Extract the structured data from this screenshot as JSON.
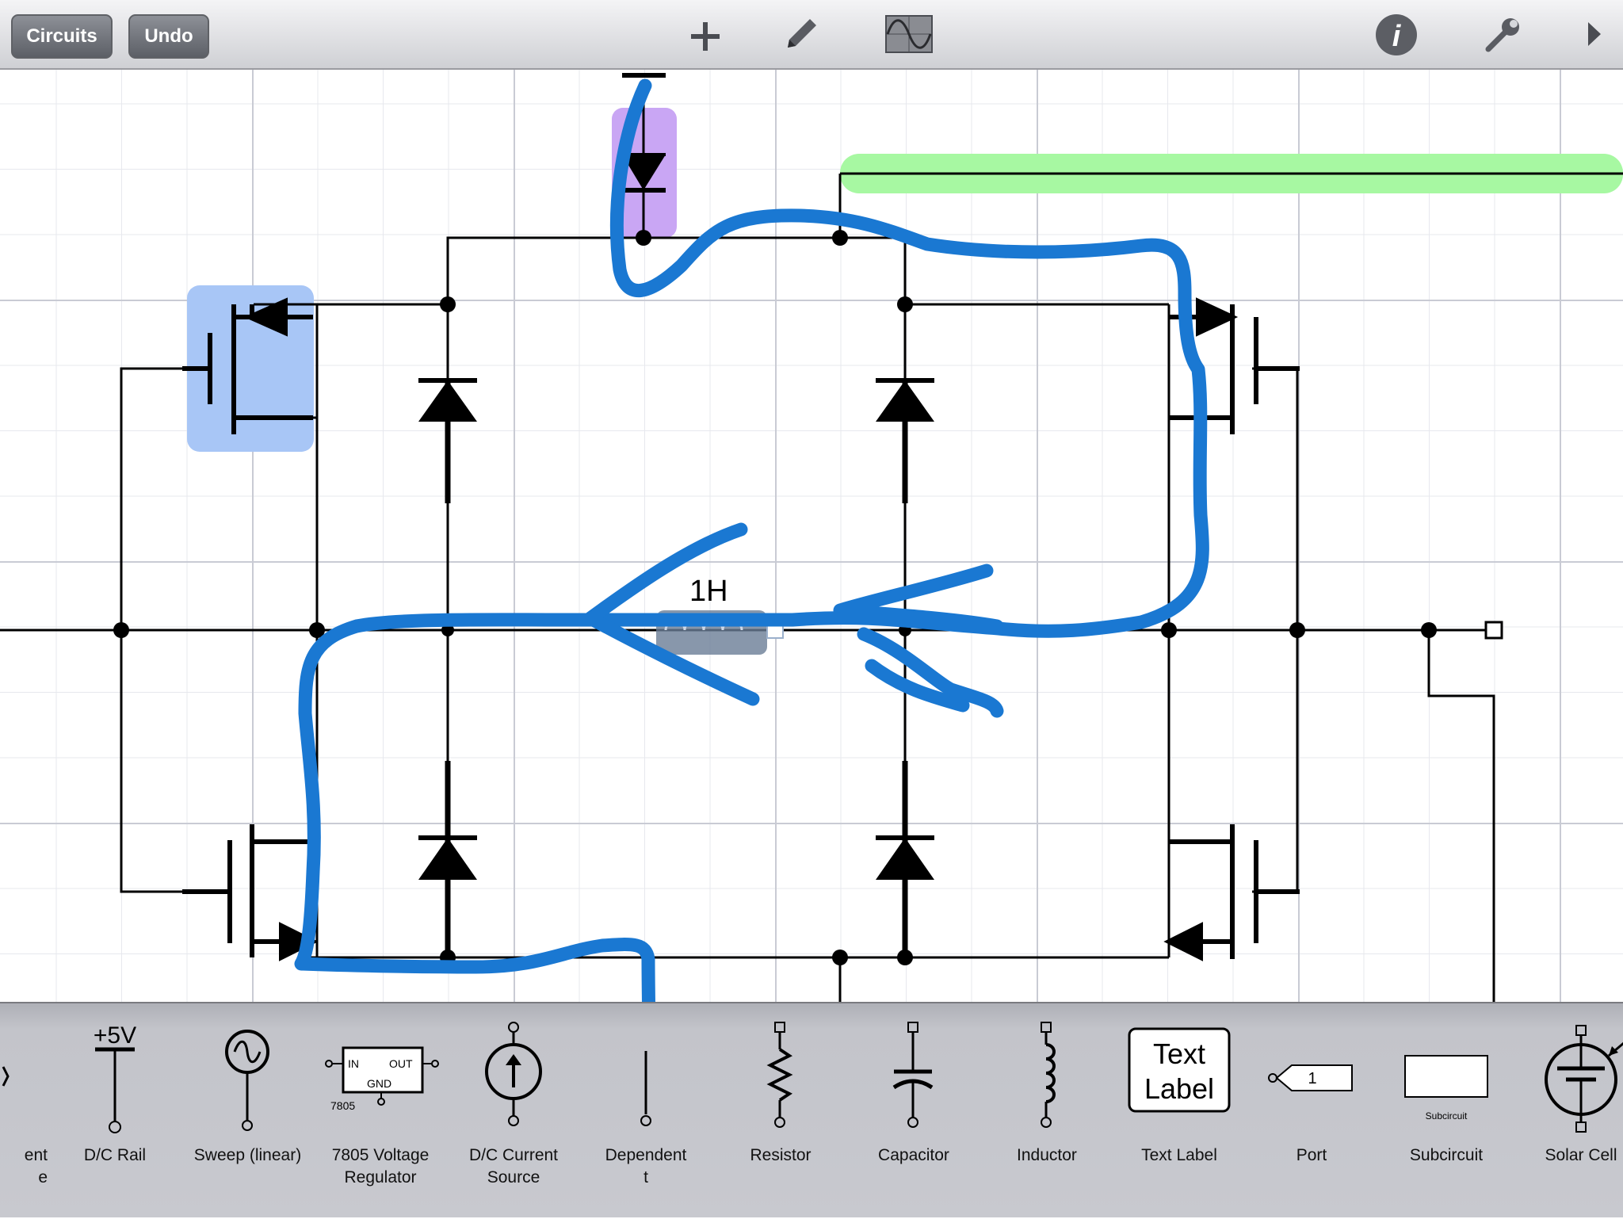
{
  "toolbar": {
    "circuits_label": "Circuits",
    "undo_label": "Undo",
    "icons": [
      "add-icon",
      "pencil-icon",
      "oscilloscope-icon",
      "info-icon",
      "wrench-icon",
      "play-icon"
    ]
  },
  "canvas": {
    "inductor_label": "1H"
  },
  "palette": {
    "items": [
      {
        "label": "ent\ne",
        "icon": "partial-component-icon"
      },
      {
        "label": "D/C Rail",
        "icon": "dc-rail-icon",
        "rail_value": "+5V"
      },
      {
        "label": "Sweep (linear)",
        "icon": "sweep-source-icon"
      },
      {
        "label": "7805 Voltage\nRegulator",
        "icon": "regulator-icon",
        "in": "IN",
        "out": "OUT",
        "gnd": "GND",
        "part": "7805"
      },
      {
        "label": "D/C Current\nSource",
        "icon": "current-source-icon"
      },
      {
        "label": "Dependent\nt",
        "icon": "dependent-source-icon"
      },
      {
        "label": "Resistor",
        "icon": "resistor-icon"
      },
      {
        "label": "Capacitor",
        "icon": "capacitor-icon"
      },
      {
        "label": "Inductor",
        "icon": "inductor-icon"
      },
      {
        "label": "Text Label",
        "icon": "text-label-icon",
        "preview_line1": "Text",
        "preview_line2": "Label"
      },
      {
        "label": "Port",
        "icon": "port-icon",
        "port_number": "1"
      },
      {
        "label": "Subcircuit",
        "icon": "subcircuit-icon",
        "caption": "Subcircuit"
      },
      {
        "label": "Solar Cell",
        "icon": "solar-cell-icon"
      }
    ]
  },
  "colors": {
    "annotation_blue": "#1a78d2",
    "highlight_blue": "#a8c6f6",
    "highlight_purple": "#c9a6f4",
    "highlight_green": "#a7f8a2",
    "wire": "#000000"
  }
}
